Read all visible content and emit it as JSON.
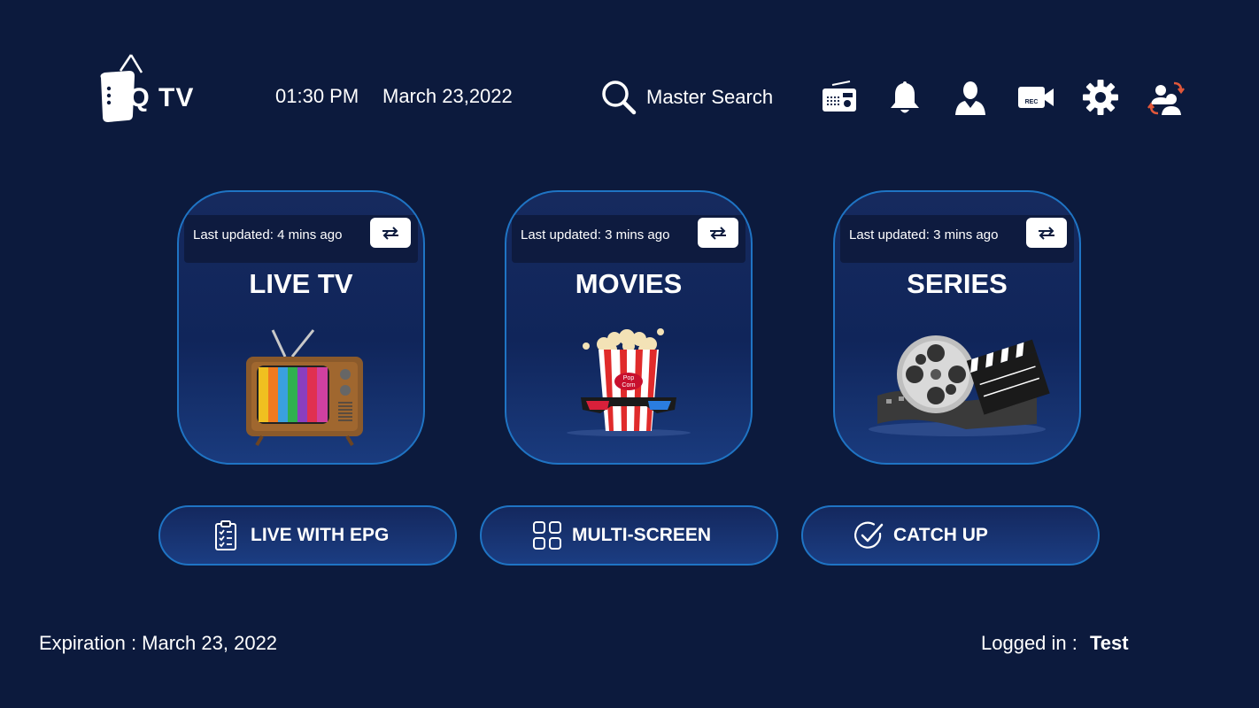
{
  "header": {
    "logo_text": "IQ TV",
    "time": "01:30 PM",
    "date": "March 23,2022",
    "search_label": "Master Search",
    "icons": [
      "radio-icon",
      "bell-icon",
      "user-icon",
      "rec-camera-icon",
      "gear-icon",
      "switch-user-icon"
    ]
  },
  "cards": [
    {
      "updated": "Last updated: 4 mins ago",
      "title": "LIVE TV"
    },
    {
      "updated": "Last updated: 3 mins ago",
      "title": "MOVIES"
    },
    {
      "updated": "Last updated: 3 mins ago",
      "title": "SERIES"
    }
  ],
  "buttons": [
    {
      "label": "LIVE WITH EPG",
      "icon": "clipboard-check-icon"
    },
    {
      "label": "MULTI-SCREEN",
      "icon": "grid-icon"
    },
    {
      "label": "CATCH UP",
      "icon": "check-circle-icon"
    }
  ],
  "footer": {
    "expiration": "Expiration : March 23, 2022",
    "logged_in_label": "Logged in :",
    "logged_in_user": "Test"
  },
  "colors": {
    "background": "#0c1a3d",
    "accent_border": "#1f74c4",
    "card_bar": "#0e1b3f"
  }
}
